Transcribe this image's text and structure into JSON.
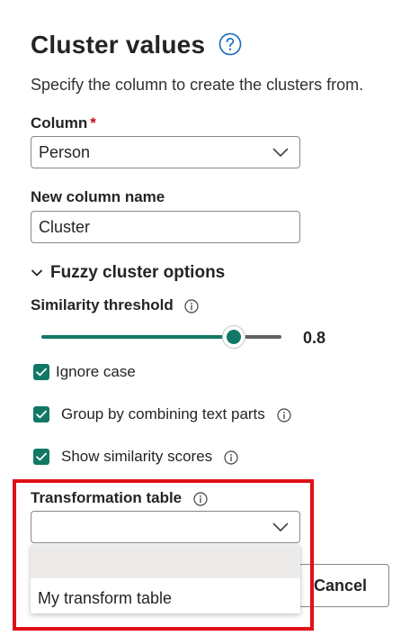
{
  "dialog": {
    "title": "Cluster values",
    "subtitle": "Specify the column to create the clusters from."
  },
  "column": {
    "label": "Column",
    "required_marker": "*",
    "value": "Person"
  },
  "new_column": {
    "label": "New column name",
    "value": "Cluster"
  },
  "fuzzy": {
    "section_label": "Fuzzy cluster options",
    "similarity_label": "Similarity threshold",
    "similarity_value": "0.8",
    "similarity_fraction": 0.8
  },
  "checkboxes": [
    {
      "label": "Ignore case",
      "checked": true
    },
    {
      "label": "Group by combining text parts",
      "checked": true
    },
    {
      "label": "Show similarity scores",
      "checked": true
    }
  ],
  "transformation_table": {
    "label": "Transformation table",
    "value": "",
    "options": [
      "",
      "My transform table"
    ]
  },
  "footer": {
    "cancel_label": "Cancel"
  },
  "colors": {
    "accent": "#117865",
    "highlight_border": "#e0101a",
    "required": "#c50f1f"
  },
  "icons": {
    "help": "question-circle-icon",
    "info": "info-circle-icon",
    "dropdown": "chevron-down-icon",
    "section": "chevron-down-icon",
    "check": "checkmark-icon"
  }
}
